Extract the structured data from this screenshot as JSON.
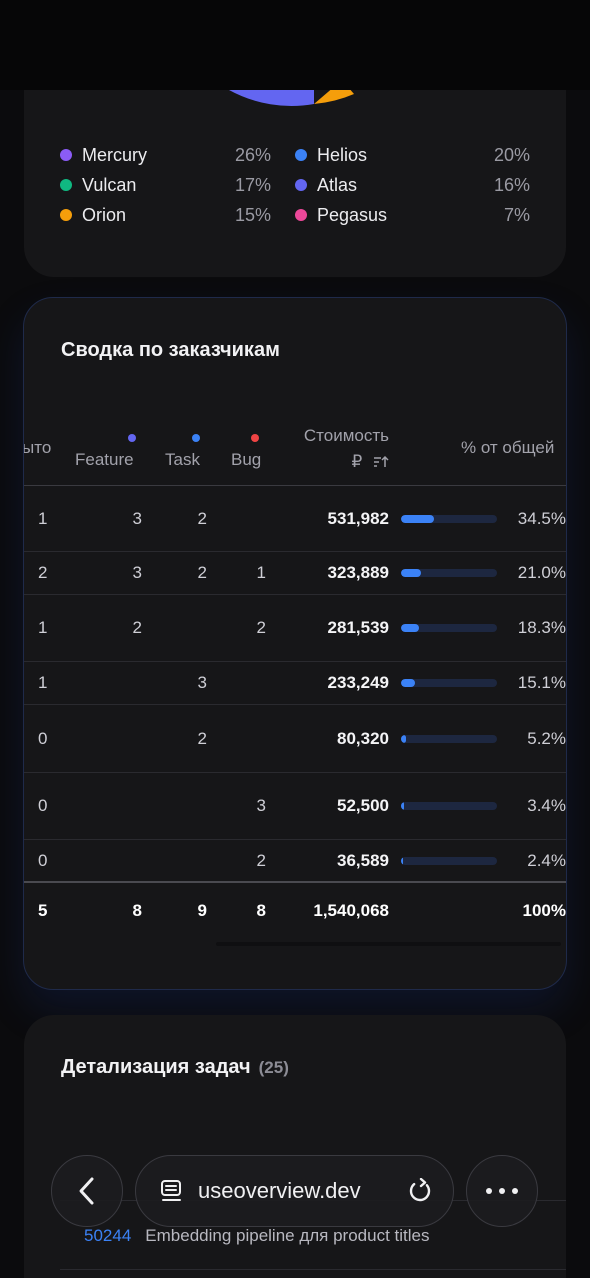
{
  "legend": [
    {
      "name": "Mercury",
      "pct": "26%",
      "color": "#8b5cf6"
    },
    {
      "name": "Helios",
      "pct": "20%",
      "color": "#3b82f6"
    },
    {
      "name": "Vulcan",
      "pct": "17%",
      "color": "#10b981"
    },
    {
      "name": "Atlas",
      "pct": "16%",
      "color": "#6366f1"
    },
    {
      "name": "Orion",
      "pct": "15%",
      "color": "#f59e0b"
    },
    {
      "name": "Pegasus",
      "pct": "7%",
      "color": "#ec4899"
    }
  ],
  "summary": {
    "title": "Сводка по заказчикам",
    "headers": {
      "col0": "ыто",
      "feature": "Feature",
      "task": "Task",
      "bug": "Bug",
      "cost_line1": "Стоимость",
      "cost_line2": "₽",
      "share": "% от общей"
    },
    "header_dot_colors": {
      "feature": "#6366f1",
      "task": "#3b82f6",
      "bug": "#ef4444"
    },
    "rows": [
      {
        "c0": "1",
        "feature": "3",
        "task": "2",
        "bug": "",
        "cost": "531,982",
        "share": "34.5%",
        "share_value": 34.5
      },
      {
        "c0": "2",
        "feature": "3",
        "task": "2",
        "bug": "1",
        "cost": "323,889",
        "share": "21.0%",
        "share_value": 21.0
      },
      {
        "c0": "1",
        "feature": "2",
        "task": "",
        "bug": "2",
        "cost": "281,539",
        "share": "18.3%",
        "share_value": 18.3
      },
      {
        "c0": "1",
        "feature": "",
        "task": "3",
        "bug": "",
        "cost": "233,249",
        "share": "15.1%",
        "share_value": 15.1
      },
      {
        "c0": "0",
        "feature": "",
        "task": "2",
        "bug": "",
        "cost": "80,320",
        "share": "5.2%",
        "share_value": 5.2
      },
      {
        "c0": "0",
        "feature": "",
        "task": "",
        "bug": "3",
        "cost": "52,500",
        "share": "3.4%",
        "share_value": 3.4
      },
      {
        "c0": "0",
        "feature": "",
        "task": "",
        "bug": "2",
        "cost": "36,589",
        "share": "2.4%",
        "share_value": 2.4
      }
    ],
    "total": {
      "c0": "5",
      "feature": "8",
      "task": "9",
      "bug": "8",
      "cost": "1,540,068",
      "share": "100%"
    }
  },
  "details": {
    "title": "Детализация задач",
    "count": "(25)",
    "task_id": "50244",
    "task_name": "Embedding pipeline для product titles"
  },
  "browser": {
    "url": "useoverview.dev"
  },
  "colors": {
    "accent": "#3b82f6",
    "card_bg": "#161618",
    "page_bg": "#0b0b0d"
  }
}
